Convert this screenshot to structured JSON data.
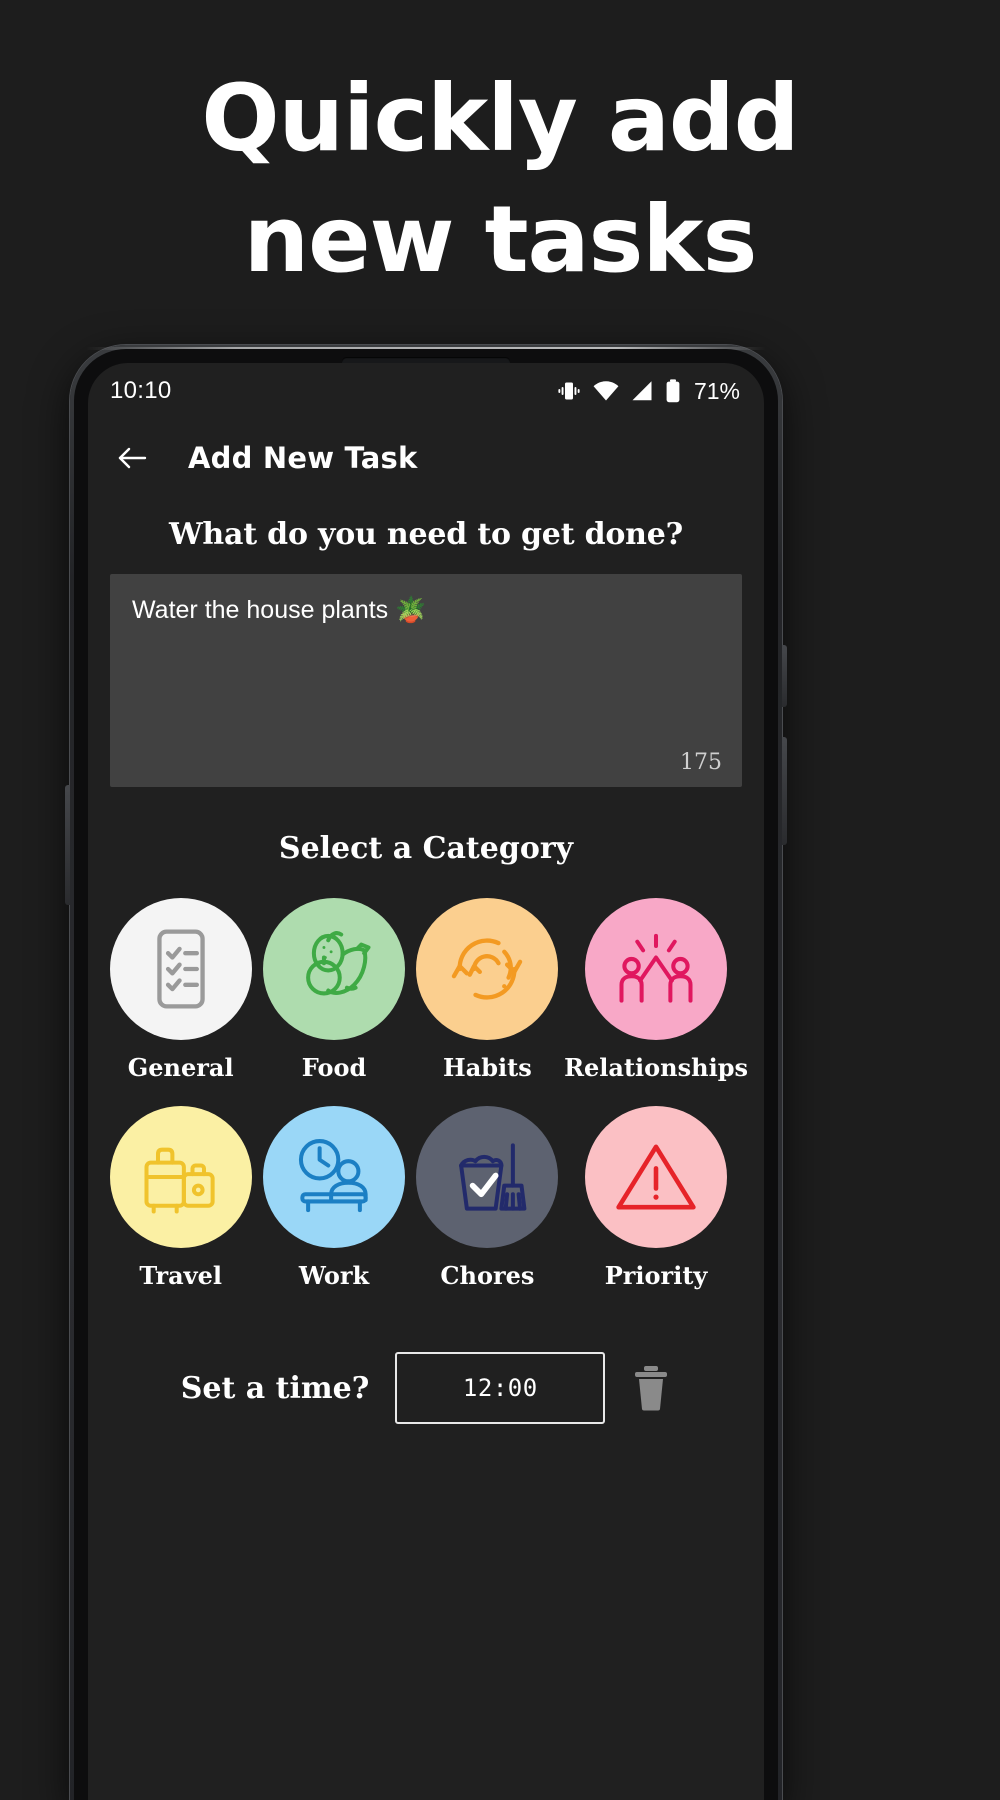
{
  "promo": {
    "headline_line1": "Quickly add",
    "headline_line2": "new tasks",
    "background_color": "#1d1d1d",
    "text_color": "#ffffff"
  },
  "status_bar": {
    "time": "10:10",
    "battery_percent": "71%",
    "icons": [
      "vibrate-icon",
      "wifi-icon",
      "signal-icon",
      "battery-icon"
    ]
  },
  "app_bar": {
    "back_icon": "back-arrow-icon",
    "title": "Add New Task"
  },
  "task_input": {
    "prompt": "What do you need to get done?",
    "value": "Water the house plants 🪴",
    "placeholder": "Water the house plants",
    "char_count": "175",
    "field_color": "#414141"
  },
  "category_section": {
    "heading": "Select a Category",
    "categories": [
      {
        "label": "General",
        "icon": "checklist-icon",
        "bg": "#f4f4f4",
        "stroke": "#9a9a9a"
      },
      {
        "label": "Food",
        "icon": "fruits-icon",
        "bg": "#aedcae",
        "stroke": "#3faa45"
      },
      {
        "label": "Habits",
        "icon": "cycle-arrows-icon",
        "bg": "#fbcf8f",
        "stroke": "#f39a22"
      },
      {
        "label": "Relationships",
        "icon": "high-five-icon",
        "bg": "#f8a8c7",
        "stroke": "#e0175f"
      },
      {
        "label": "Travel",
        "icon": "luggage-icon",
        "bg": "#fbf0a4",
        "stroke": "#f0c32c"
      },
      {
        "label": "Work",
        "icon": "desk-clock-icon",
        "bg": "#9ad7f7",
        "stroke": "#1b7fc4"
      },
      {
        "label": "Chores",
        "icon": "bucket-broom-icon",
        "bg": "#5d6270",
        "stroke": "#222a6b"
      },
      {
        "label": "Priority",
        "icon": "warning-icon",
        "bg": "#fbc0c4",
        "stroke": "#e62329"
      }
    ]
  },
  "time_section": {
    "label": "Set a time?",
    "time_value": "12:00",
    "delete_icon": "trash-icon"
  }
}
